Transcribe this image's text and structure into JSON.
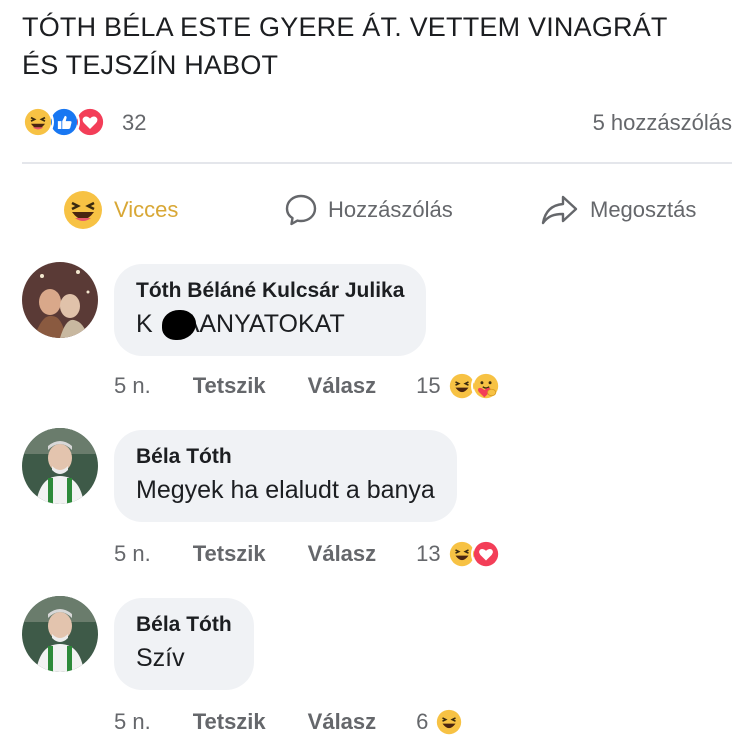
{
  "post": {
    "text_line1": "TÓTH BÉLA ESTE GYERE ÁT. VETTEM VINAGRÁT",
    "text_line2": "ÉS TEJSZÍN HABOT"
  },
  "stats": {
    "reaction_icons": [
      "haha-icon",
      "like-icon",
      "love-icon"
    ],
    "reaction_count": "32",
    "comment_count": "5 hozzászólás"
  },
  "actions": {
    "reacted_label": "Vicces",
    "comment_label": "Hozzászólás",
    "share_label": "Megosztás"
  },
  "colors": {
    "haha_yellow": "#f7c244",
    "like_blue": "#1877f2",
    "love_red": "#f33e58",
    "secondary_text": "#65676b",
    "bubble_bg": "#f0f2f5"
  },
  "comments": [
    {
      "author": "Tóth Béláné Kulcsár Julika",
      "text_before": "K",
      "text_after": "AANYATOKAT",
      "time": "5 n.",
      "like_label": "Tetszik",
      "reply_label": "Válasz",
      "reaction_count": "15",
      "reaction_icons": [
        "haha-icon",
        "care-icon"
      ]
    },
    {
      "author": "Béla Tóth",
      "text": "Megyek ha elaludt a banya",
      "time": "5 n.",
      "like_label": "Tetszik",
      "reply_label": "Válasz",
      "reaction_count": "13",
      "reaction_icons": [
        "haha-icon",
        "love-icon"
      ]
    },
    {
      "author": "Béla Tóth",
      "text": "Szív",
      "time": "5 n.",
      "like_label": "Tetszik",
      "reply_label": "Válasz",
      "reaction_count": "6",
      "reaction_icons": [
        "haha-icon"
      ]
    }
  ]
}
